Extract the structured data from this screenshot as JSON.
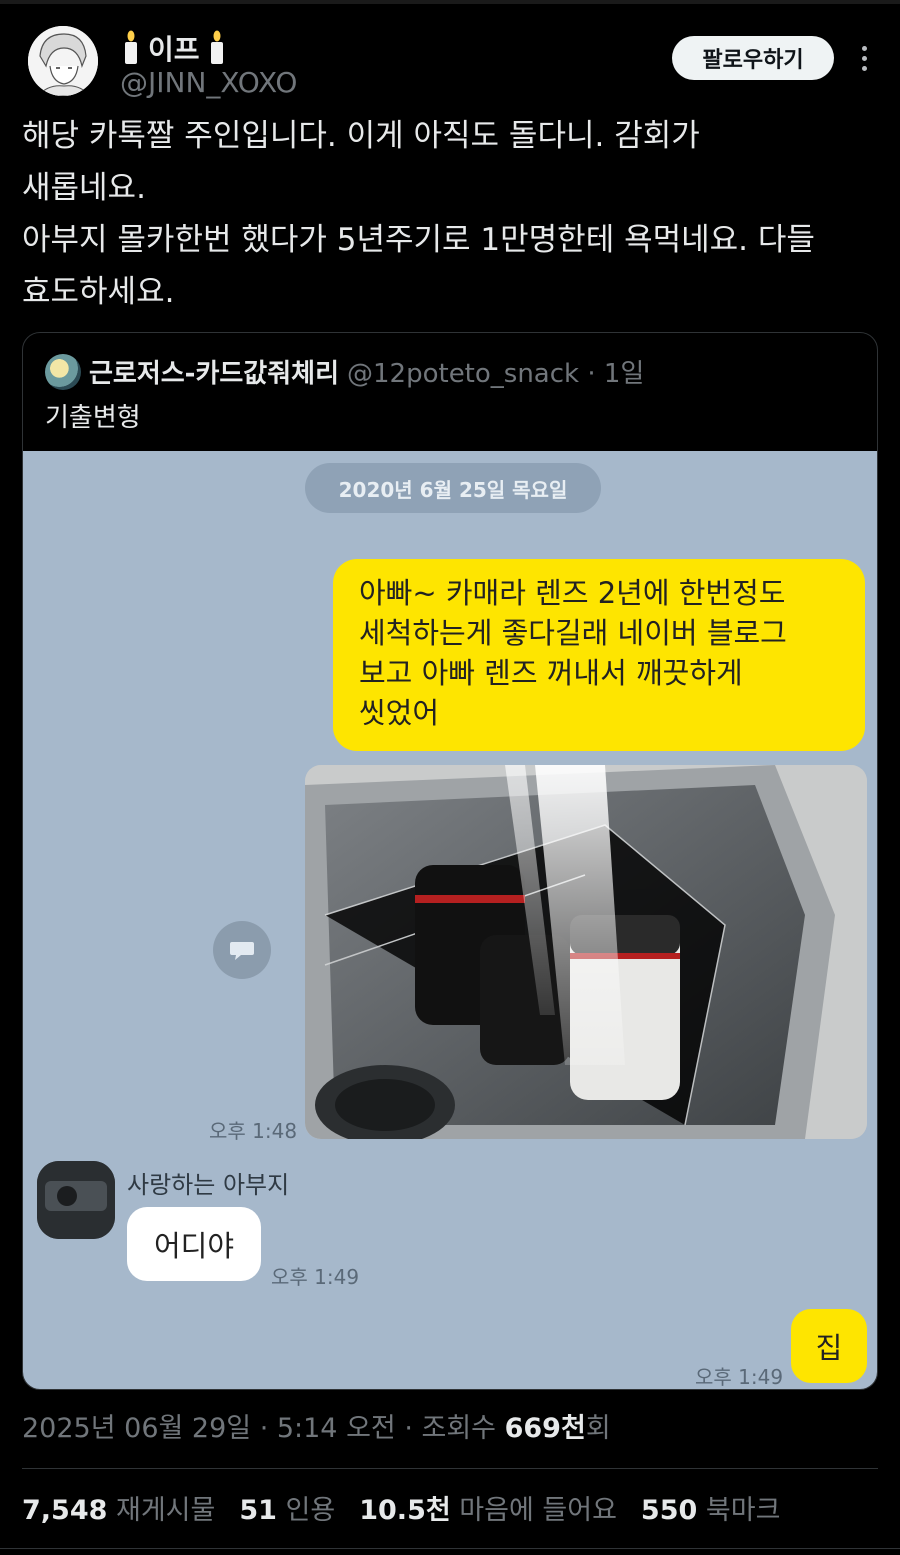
{
  "author": {
    "display_name": "이프",
    "handle": "@JINN_XOXO",
    "follow_label": "팔로우하기"
  },
  "tweet": {
    "text": "해당 카톡짤 주인입니다. 이게 아직도 돌다니. 감회가\n새롭네요.\n아부지 몰카한번 했다가 5년주기로 1만명한테 욕먹네요. 다들\n효도하세요."
  },
  "quote": {
    "display_name": "근로저스-카드값줘체리",
    "handle_time": "@12poteto_snack · 1일",
    "text": "기출변형",
    "chat": {
      "date": "2020년 6월 25일 목요일",
      "my_message": "아빠~ 카매라 렌즈 2년에 한번정도\n세척하는게 좋다길래 네이버 블로그\n보고  아빠 렌즈 꺼내서 깨끗하게\n씻었어",
      "photo_time": "오후 1:48",
      "friend_name": "사랑하는 아부지",
      "friend_message": "어디야",
      "friend_time": "오후 1:49",
      "reply": "집",
      "reply_time": "오후 1:49"
    }
  },
  "meta": {
    "datetime": "2025년 06월 29일 · 5:14 오전 · 조회수 ",
    "views": "669천",
    "views_suffix": "회"
  },
  "stats": {
    "reposts_count": "7,548",
    "reposts_label": "재게시물",
    "quotes_count": "51",
    "quotes_label": "인용",
    "likes_count": "10.5천",
    "likes_label": "마음에 들어요",
    "bookmarks_count": "550",
    "bookmarks_label": "북마크"
  },
  "colors": {
    "background": "#000000",
    "chat_bg": "#a6b8cb",
    "kakao_yellow": "#fee500"
  }
}
